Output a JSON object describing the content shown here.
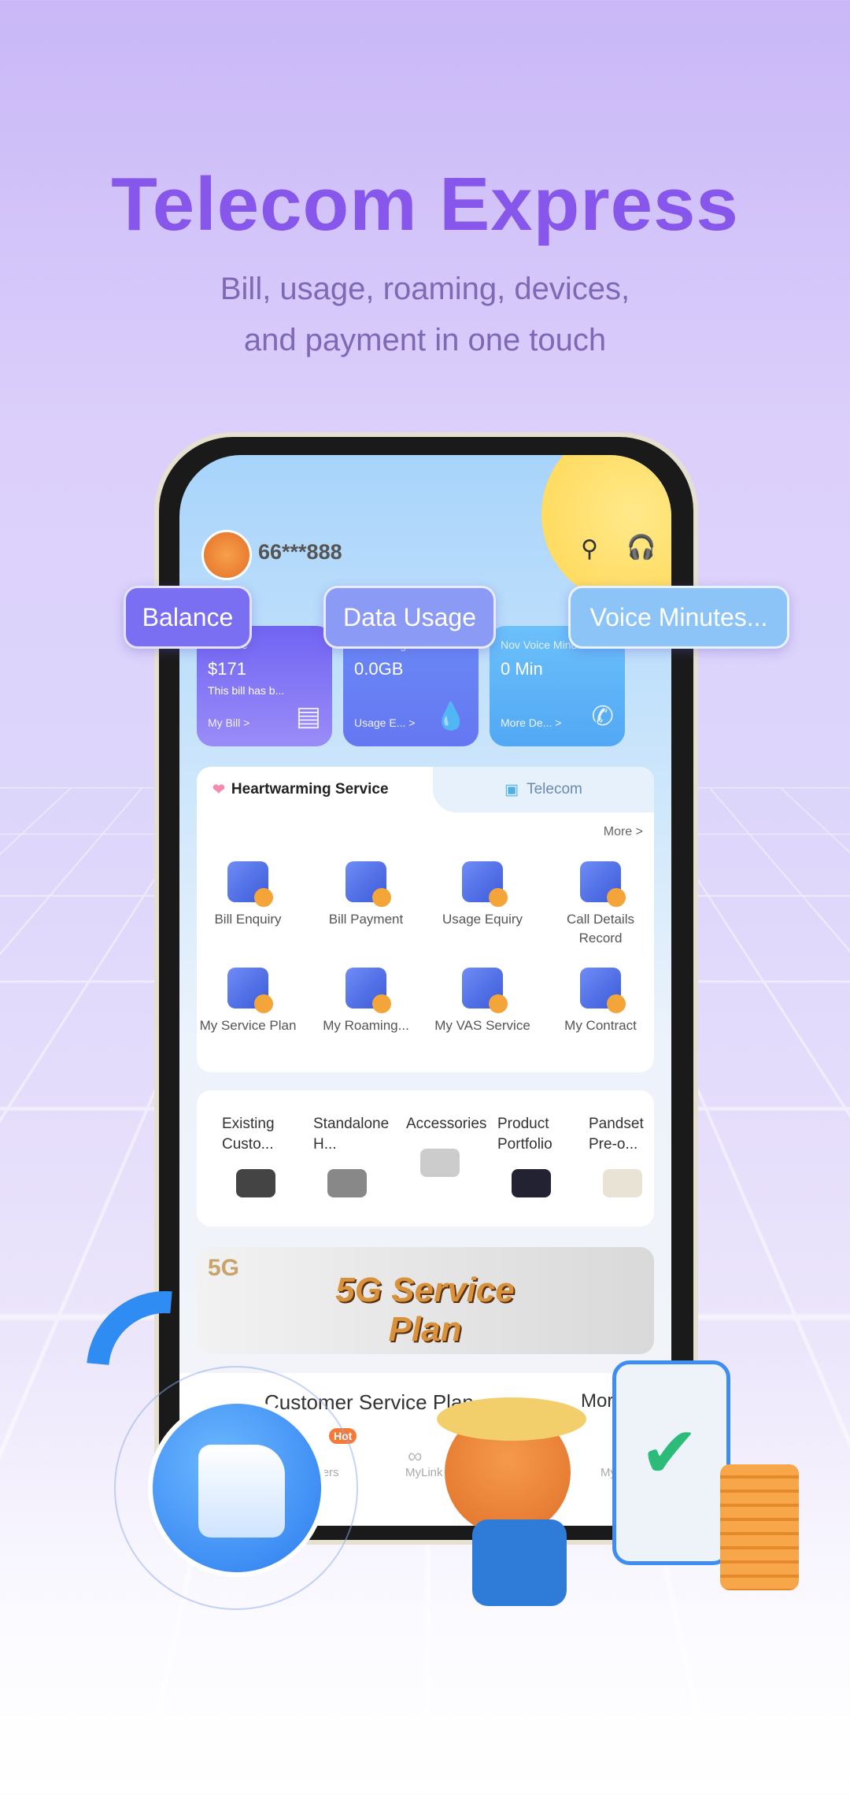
{
  "promo": {
    "title": "Telecom Express",
    "subtitle_line1": "Bill, usage, roaming, devices,",
    "subtitle_line2": "and payment in one touch"
  },
  "header": {
    "phone_number": "66***888",
    "search_icon": "search-icon",
    "support_icon": "headset-icon"
  },
  "callouts": [
    "Balance",
    "Data Usage",
    "Voice Minutes..."
  ],
  "cards": [
    {
      "label": "Balance",
      "value": "$171",
      "note": "This bill has b...",
      "link": "My Bill >",
      "icon": "bill-icon",
      "color": "#7b6cf4"
    },
    {
      "label": "Data Usage",
      "value": "0.0GB",
      "link": "Usage E... >",
      "icon": "data-drop-icon",
      "color": "#6a8af5"
    },
    {
      "label": "Nov Voice Minutes",
      "value": "0 Min",
      "link": "More De... >",
      "icon": "phone-icon",
      "color": "#5fb2f7"
    }
  ],
  "tabs": [
    {
      "label": "Heartwarming Service",
      "active": true
    },
    {
      "label": "Telecom",
      "active": false
    }
  ],
  "more": "More >",
  "services": [
    "Bill Enquiry",
    "Bill Payment",
    "Usage Equiry",
    "Call Details Record",
    "My Service Plan",
    "My Roaming...",
    "My VAS Service",
    "My Contract"
  ],
  "products": [
    "Existing Custo...",
    "Standalone H...",
    "Accessories",
    "Product Portfolio",
    "Pandset Pre-o..."
  ],
  "banner": {
    "title": "5G Service Plan",
    "badge": "5G"
  },
  "customer_section": {
    "title": "Customer Service Plan",
    "more": "More",
    "items": [
      "Vouchers",
      "MyLink",
      "My"
    ],
    "hot_badge": "Hot"
  }
}
